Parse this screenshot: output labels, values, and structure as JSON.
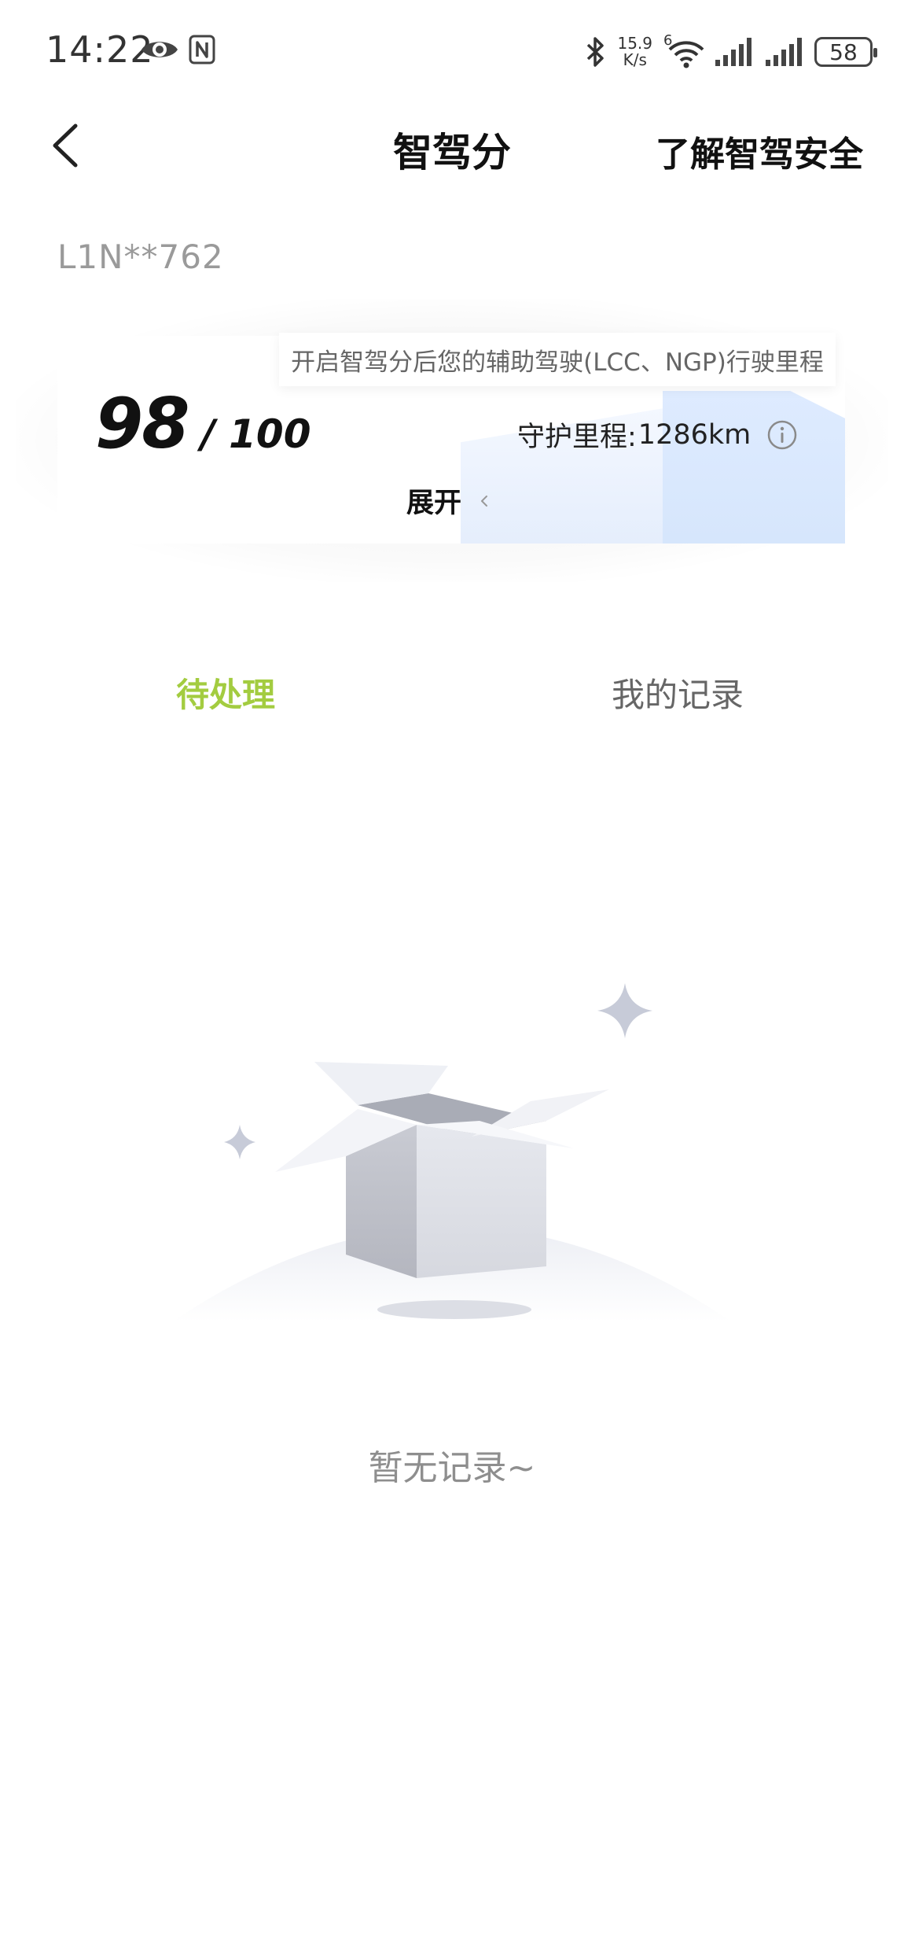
{
  "status_bar": {
    "time": "14:22",
    "network_speed_value": "15.9",
    "network_speed_unit": "K/s",
    "wifi_badge": "6",
    "battery": "58",
    "icons": [
      "eye-icon",
      "nfc-icon",
      "bluetooth-icon",
      "wifi-icon",
      "signal-icon",
      "signal-icon",
      "battery-icon"
    ]
  },
  "nav": {
    "back_icon": "chevron-left-icon",
    "title": "智驾分",
    "link": "了解智驾安全"
  },
  "plate": "L1N**762",
  "score_card": {
    "score": "98",
    "total": "/ 100",
    "tooltip": "开启智驾分后您的辅助驾驶(LCC、NGP)行驶里程",
    "mileage_label": "守护里程:",
    "mileage_value": "1286km",
    "info_icon": "info-icon",
    "expand_label": "展开",
    "expand_icon": "chevron-left-icon"
  },
  "tabs": [
    {
      "label": "待处理",
      "active": true
    },
    {
      "label": "我的记录",
      "active": false
    }
  ],
  "empty_state": {
    "illustration": "empty-box-illustration",
    "text": "暂无记录~"
  },
  "colors": {
    "accent": "#a3cc40",
    "muted_text": "#8e8e8e",
    "card_deco": "#deebff"
  }
}
